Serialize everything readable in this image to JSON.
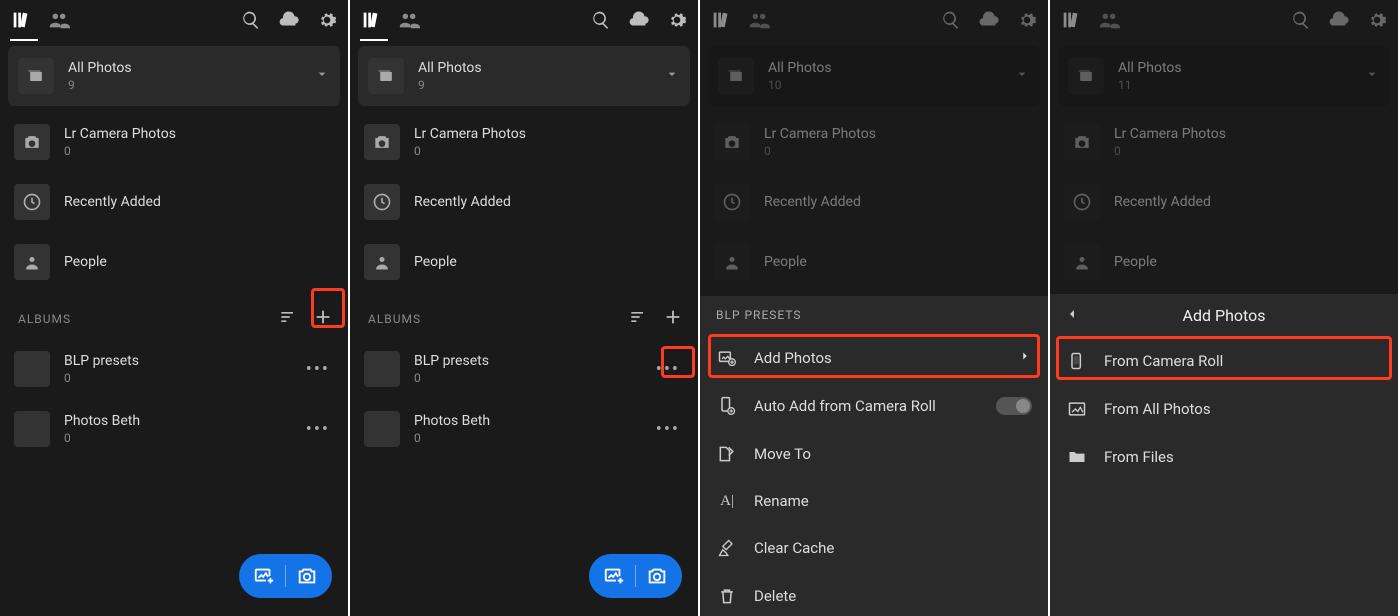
{
  "panels": [
    {
      "all_count": "9",
      "albums_hl": "plus",
      "blp_count": "0",
      "pb_count": "0"
    },
    {
      "all_count": "9",
      "albums_hl": "dots",
      "blp_count": "0",
      "pb_count": "0"
    },
    {
      "all_count": "10",
      "sheet": "album_menu"
    },
    {
      "all_count": "11",
      "sheet": "add_photos"
    }
  ],
  "labels": {
    "all_photos": "All Photos",
    "lr_camera": "Lr Camera Photos",
    "lr_camera_count": "0",
    "recently_added": "Recently Added",
    "people": "People",
    "albums": "ALBUMS",
    "blp_presets": "BLP presets",
    "photos_beth": "Photos Beth"
  },
  "sheet_album": {
    "header": "BLP PRESETS",
    "add_photos": "Add Photos",
    "auto_add": "Auto Add from Camera Roll",
    "move_to": "Move To",
    "rename": "Rename",
    "clear_cache": "Clear Cache",
    "delete": "Delete"
  },
  "sheet_add": {
    "header": "Add Photos",
    "from_camera_roll": "From Camera Roll",
    "from_all_photos": "From All Photos",
    "from_files": "From Files"
  }
}
